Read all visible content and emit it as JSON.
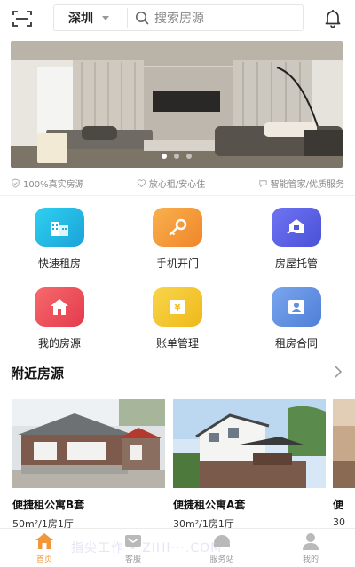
{
  "header": {
    "city": "深圳",
    "search_placeholder": "搜索房源"
  },
  "guarantees": [
    {
      "label": "100%真实房源",
      "icon": "shield-check-icon"
    },
    {
      "label": "放心租/安心住",
      "icon": "heart-icon"
    },
    {
      "label": "智能管家/优质服务",
      "icon": "chat-bubble-icon"
    }
  ],
  "features": [
    {
      "label": "快速租房",
      "icon": "building-icon",
      "color": "#22b7e3"
    },
    {
      "label": "手机开门",
      "icon": "key-icon",
      "color": "#f39a3a"
    },
    {
      "label": "房屋托管",
      "icon": "house-hand-icon",
      "color": "#5a63e8"
    },
    {
      "label": "我的房源",
      "icon": "home-icon",
      "color": "#ef4f5a"
    },
    {
      "label": "账单管理",
      "icon": "bill-icon",
      "color": "#f3c52a"
    },
    {
      "label": "租房合同",
      "icon": "contract-icon",
      "color": "#5f8fe0"
    }
  ],
  "nearby": {
    "title": "附近房源",
    "listings": [
      {
        "title": "便捷租公寓B套",
        "detail": "50m²/1房1厅"
      },
      {
        "title": "便捷租公寓A套",
        "detail": "30m²/1房1厅"
      },
      {
        "title": "便",
        "detail": "30"
      }
    ]
  },
  "tabs": [
    {
      "label": "首页",
      "icon": "home-tab-icon",
      "active": true
    },
    {
      "label": "客服",
      "icon": "service-tab-icon",
      "active": false
    },
    {
      "label": "服务站",
      "icon": "station-tab-icon",
      "active": false
    },
    {
      "label": "我的",
      "icon": "profile-tab-icon",
      "active": false
    }
  ],
  "watermark": "指尖工作 • ZIHI···.COM",
  "colors": {
    "accent": "#f2963a",
    "muted": "#9a9a9a"
  }
}
